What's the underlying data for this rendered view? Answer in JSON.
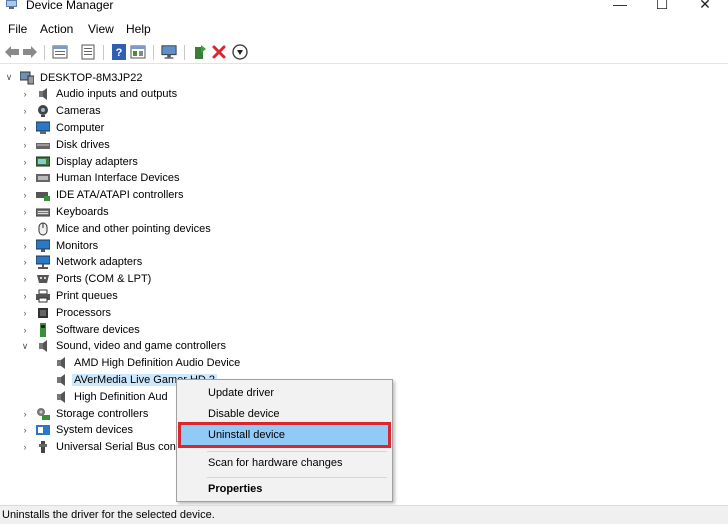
{
  "window": {
    "title": "Device Manager",
    "buttons": {
      "minimize": "—",
      "maximize": "☐",
      "close": "✕"
    }
  },
  "menu": [
    "File",
    "Action",
    "View",
    "Help"
  ],
  "toolbar": {
    "icons": [
      "back-arrow-icon",
      "forward-arrow-icon",
      "properties-view-icon",
      "list-view-icon",
      "help-icon",
      "details-view-icon",
      "monitor-scan-icon",
      "update-driver-icon",
      "uninstall-x-icon",
      "download-driver-icon"
    ],
    "uninstall_color": "#d9262f"
  },
  "tree": {
    "root": "DESKTOP-8M3JP22",
    "categories": [
      {
        "label": "Audio inputs and outputs",
        "icon": "speaker-icon"
      },
      {
        "label": "Cameras",
        "icon": "camera-icon"
      },
      {
        "label": "Computer",
        "icon": "computer-icon"
      },
      {
        "label": "Disk drives",
        "icon": "disk-icon"
      },
      {
        "label": "Display adapters",
        "icon": "display-adapter-icon"
      },
      {
        "label": "Human Interface Devices",
        "icon": "hid-icon"
      },
      {
        "label": "IDE ATA/ATAPI controllers",
        "icon": "ide-icon"
      },
      {
        "label": "Keyboards",
        "icon": "keyboard-icon"
      },
      {
        "label": "Mice and other pointing devices",
        "icon": "mouse-icon"
      },
      {
        "label": "Monitors",
        "icon": "monitor-icon"
      },
      {
        "label": "Network adapters",
        "icon": "network-icon"
      },
      {
        "label": "Ports (COM & LPT)",
        "icon": "port-icon"
      },
      {
        "label": "Print queues",
        "icon": "printer-icon"
      },
      {
        "label": "Processors",
        "icon": "processor-icon"
      },
      {
        "label": "Software devices",
        "icon": "software-device-icon"
      },
      {
        "label": "Sound, video and game controllers",
        "icon": "speaker-icon",
        "expanded": true
      },
      {
        "label": "Storage controllers",
        "icon": "storage-icon"
      },
      {
        "label": "System devices",
        "icon": "system-devices-icon"
      },
      {
        "label": "Universal Serial Bus con",
        "icon": "usb-icon"
      }
    ],
    "sound_children": [
      {
        "label": "AMD High Definition Audio Device",
        "icon": "speaker-icon"
      },
      {
        "label": "AVerMedia Live Gamer HD 2",
        "icon": "speaker-icon",
        "selected": true
      },
      {
        "label": "High Definition Aud",
        "icon": "speaker-icon"
      }
    ]
  },
  "context_menu": {
    "items": [
      {
        "label": "Update driver"
      },
      {
        "label": "Disable device"
      },
      {
        "label": "Uninstall device",
        "highlighted": true
      },
      {
        "label": "Scan for hardware changes"
      },
      {
        "label": "Properties",
        "bold": true
      }
    ]
  },
  "status": {
    "text": "Uninstalls the driver for the selected device."
  }
}
